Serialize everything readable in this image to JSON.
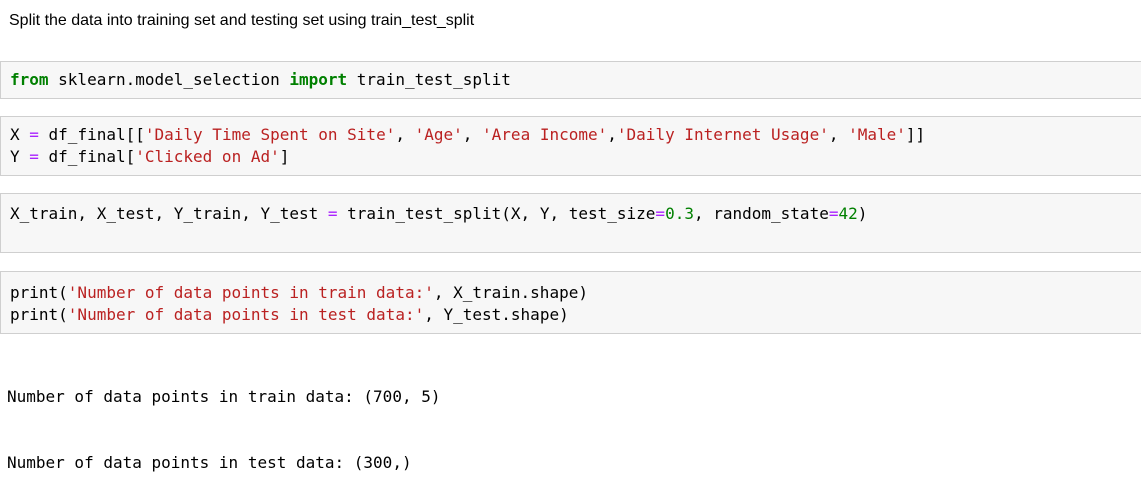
{
  "markdown": {
    "text": "Split the data into training set and testing set using train_test_split"
  },
  "cells": [
    {
      "lines": [
        [
          {
            "t": "from",
            "c": "kw"
          },
          {
            "t": " sklearn.model_selection ",
            "c": ""
          },
          {
            "t": "import",
            "c": "kw"
          },
          {
            "t": " train_test_split",
            "c": ""
          }
        ]
      ]
    },
    {
      "lines": [
        [
          {
            "t": "X ",
            "c": ""
          },
          {
            "t": "=",
            "c": "op"
          },
          {
            "t": " df_final[[",
            "c": ""
          },
          {
            "t": "'Daily Time Spent on Site'",
            "c": "str"
          },
          {
            "t": ", ",
            "c": ""
          },
          {
            "t": "'Age'",
            "c": "str"
          },
          {
            "t": ", ",
            "c": ""
          },
          {
            "t": "'Area Income'",
            "c": "str"
          },
          {
            "t": ",",
            "c": ""
          },
          {
            "t": "'Daily Internet Usage'",
            "c": "str"
          },
          {
            "t": ", ",
            "c": ""
          },
          {
            "t": "'Male'",
            "c": "str"
          },
          {
            "t": "]]",
            "c": ""
          }
        ],
        [
          {
            "t": "Y ",
            "c": ""
          },
          {
            "t": "=",
            "c": "op"
          },
          {
            "t": " df_final[",
            "c": ""
          },
          {
            "t": "'Clicked on Ad'",
            "c": "str"
          },
          {
            "t": "]",
            "c": ""
          }
        ]
      ]
    },
    {
      "lines": [
        [
          {
            "t": "X_train, X_test, Y_train, Y_test ",
            "c": ""
          },
          {
            "t": "=",
            "c": "op"
          },
          {
            "t": " train_test_split(X, Y, test_size",
            "c": ""
          },
          {
            "t": "=",
            "c": "op"
          },
          {
            "t": "0.3",
            "c": "num"
          },
          {
            "t": ", random_state",
            "c": ""
          },
          {
            "t": "=",
            "c": "op"
          },
          {
            "t": "42",
            "c": "num"
          },
          {
            "t": ")",
            "c": ""
          }
        ]
      ]
    },
    {
      "lines": [
        [
          {
            "t": "print(",
            "c": ""
          },
          {
            "t": "'Number of data points in train data:'",
            "c": "str"
          },
          {
            "t": ", X_train.shape)",
            "c": ""
          }
        ],
        [
          {
            "t": "print(",
            "c": ""
          },
          {
            "t": "'Number of data points in test data:'",
            "c": "str"
          },
          {
            "t": ", Y_test.shape)",
            "c": ""
          }
        ]
      ]
    }
  ],
  "output": {
    "lines": [
      "Number of data points in train data: (700, 5)",
      "Number of data points in test data: (300,)"
    ]
  }
}
